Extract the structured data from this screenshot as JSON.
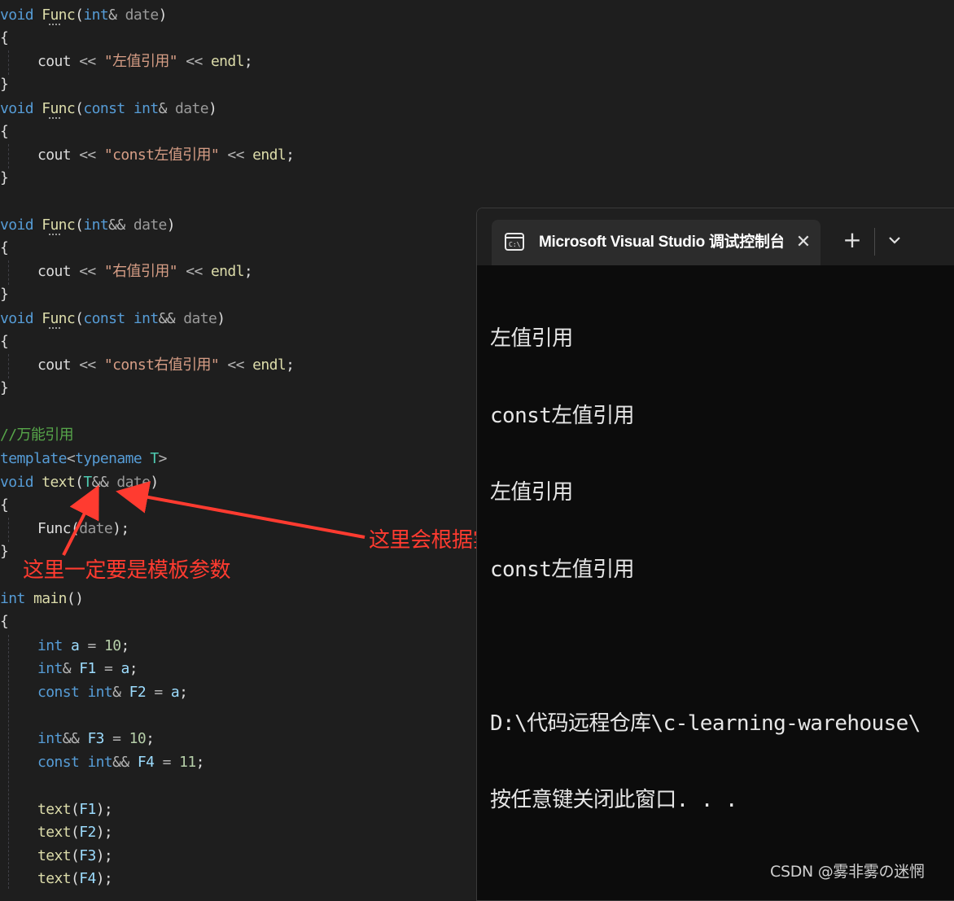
{
  "code": {
    "lines": [
      [
        "void",
        "Func",
        "(",
        "int",
        "& ",
        "date",
        ")"
      ],
      [
        "{"
      ],
      [
        "cout",
        " << ",
        "\"左值引用\"",
        " << ",
        "endl",
        ";"
      ],
      [
        "}"
      ],
      [
        "void",
        "Func",
        "(",
        "const",
        "int",
        "& ",
        "date",
        ")"
      ],
      [
        "{"
      ],
      [
        "cout",
        " << ",
        "\"const左值引用\"",
        " << ",
        "endl",
        ";"
      ],
      [
        "}"
      ],
      [
        "void",
        "Func",
        "(",
        "int",
        "&& ",
        "date",
        ")"
      ],
      [
        "{"
      ],
      [
        "cout",
        " << ",
        "\"右值引用\"",
        " << ",
        "endl",
        ";"
      ],
      [
        "}"
      ],
      [
        "void",
        "Func",
        "(",
        "const",
        "int",
        "&& ",
        "date",
        ")"
      ],
      [
        "{"
      ],
      [
        "cout",
        " << ",
        "\"const右值引用\"",
        " << ",
        "endl",
        ";"
      ],
      [
        "}"
      ],
      [
        "//万能引用"
      ],
      [
        "template",
        "<",
        "typename",
        "T",
        ">"
      ],
      [
        "void",
        "text",
        "(",
        "T",
        "&& ",
        "date",
        ")"
      ],
      [
        "{"
      ],
      [
        "Func",
        "(",
        "date",
        ");"
      ],
      [
        "}"
      ],
      [
        "int",
        "main",
        "()"
      ],
      [
        "{"
      ],
      [
        "int",
        "a",
        "=",
        "10",
        ";"
      ],
      [
        "int",
        "& ",
        "F1",
        "=",
        "a",
        ";"
      ],
      [
        "const",
        "int",
        "& ",
        "F2",
        "=",
        "a",
        ";"
      ],
      [
        "int",
        "&& ",
        "F3",
        "=",
        "10",
        ";"
      ],
      [
        "const",
        "int",
        "&& ",
        "F4",
        "=",
        "11",
        ";"
      ],
      [
        "text",
        "(",
        "F1",
        ");"
      ],
      [
        "text",
        "(",
        "F2",
        ");"
      ],
      [
        "text",
        "(",
        "F3",
        ");"
      ],
      [
        "text",
        "(",
        "F4",
        ");"
      ]
    ]
  },
  "annotations": {
    "template_param_note": "这里一定要是模板参数",
    "auto_deduce_note": "这里会根据实参类型自动变换引用类型",
    "color": "#ff3b30"
  },
  "terminal": {
    "tab_title": "Microsoft Visual Studio 调试控制台",
    "tab_icon": "console-icon",
    "close_icon": "close-icon",
    "new_tab_icon": "plus-icon",
    "dropdown_icon": "chevron-down-icon",
    "output": [
      "左值引用",
      "const左值引用",
      "左值引用",
      "const左值引用",
      "",
      "D:\\代码远程仓库\\c-learning-warehouse\\",
      "按任意键关闭此窗口. . ."
    ]
  },
  "watermark": "CSDN @雾非雾の迷惘",
  "colors": {
    "editor_bg": "#1e1e1e",
    "keyword": "#569cd6",
    "function": "#dcdcaa",
    "string": "#d69d85",
    "terminal_bg": "#0c0c0c"
  }
}
